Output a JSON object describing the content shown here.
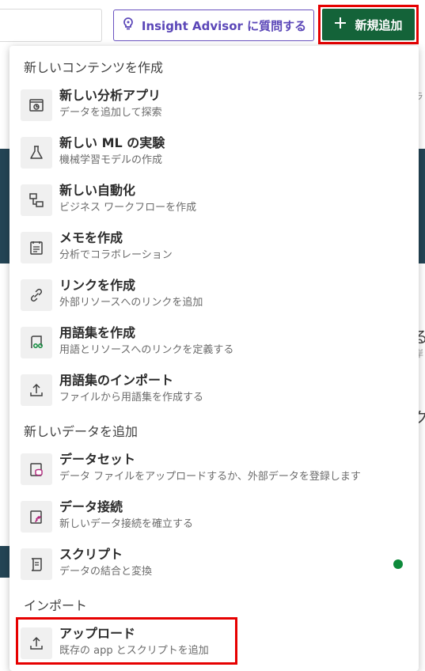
{
  "header": {
    "insight_button_label": "Insight Advisor に質問する",
    "add_new_label": "新規追加",
    "search_value": ""
  },
  "menu": {
    "section_new_content": "新しいコンテンツを作成",
    "section_new_data": "新しいデータを追加",
    "section_import": "インポート",
    "items": [
      {
        "title": "新しい分析アプリ",
        "subtitle": "データを追加して探索",
        "icon": "analytics-app-icon"
      },
      {
        "title": "新しい ML の実験",
        "subtitle": "機械学習モデルの作成",
        "icon": "flask-icon"
      },
      {
        "title": "新しい自動化",
        "subtitle": "ビジネス ワークフローを作成",
        "icon": "automation-icon"
      },
      {
        "title": "メモを作成",
        "subtitle": "分析でコラボレーション",
        "icon": "note-icon"
      },
      {
        "title": "リンクを作成",
        "subtitle": "外部リソースへのリンクを追加",
        "icon": "link-icon"
      },
      {
        "title": "用語集を作成",
        "subtitle": "用語とリソースへのリンクを定義する",
        "icon": "glossary-icon"
      },
      {
        "title": "用語集のインポート",
        "subtitle": "ファイルから用語集を作成する",
        "icon": "upload-icon"
      },
      {
        "title": "データセット",
        "subtitle": "データ ファイルをアップロードするか、外部データを登録します",
        "icon": "dataset-icon"
      },
      {
        "title": "データ接続",
        "subtitle": "新しいデータ接続を確立する",
        "icon": "data-connection-icon"
      },
      {
        "title": "スクリプト",
        "subtitle": "データの結合と変換",
        "icon": "script-icon"
      },
      {
        "title": "アップロード",
        "subtitle": "既存の app とスクリプトを追加",
        "icon": "upload-icon"
      }
    ]
  },
  "background": {
    "edge_chars": [
      "る",
      "ク"
    ],
    "edge_small": [
      "ラ",
      "岸"
    ]
  },
  "colors": {
    "brand_green": "#146339",
    "insight_purple": "#5b47b8",
    "highlight_red": "#e60000",
    "status_green": "#0d8a3a"
  }
}
